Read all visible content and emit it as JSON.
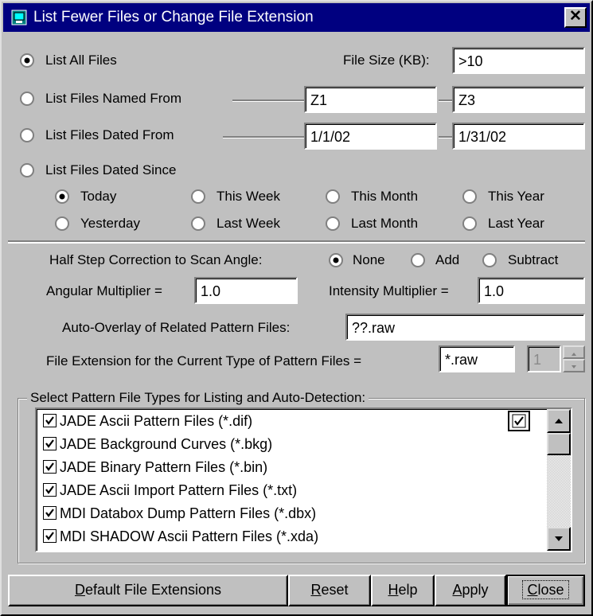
{
  "window": {
    "title": "List Fewer Files or Change File Extension",
    "close_glyph": "✕"
  },
  "filter": {
    "list_all": "List All Files",
    "file_size_label": "File Size (KB):",
    "file_size_value": ">10",
    "named_from": "List Files Named From",
    "named_from_value": "Z1",
    "named_to_value": "Z3",
    "dated_from": "List Files Dated From",
    "dated_from_value": "1/1/02",
    "dated_to_value": "1/31/02",
    "dated_since": "List Files Dated Since",
    "selected": "List All Files"
  },
  "since_options": {
    "today": "Today",
    "this_week": "This Week",
    "this_month": "This Month",
    "this_year": "This Year",
    "yesterday": "Yesterday",
    "last_week": "Last Week",
    "last_month": "Last Month",
    "last_year": "Last Year",
    "selected": "Today"
  },
  "correction": {
    "label": "Half Step Correction to Scan Angle:",
    "none": "None",
    "add": "Add",
    "subtract": "Subtract",
    "selected": "None"
  },
  "multipliers": {
    "angular_label": "Angular Multiplier =",
    "angular_value": "1.0",
    "intensity_label": "Intensity Multiplier =",
    "intensity_value": "1.0"
  },
  "overlay": {
    "label": "Auto-Overlay of Related Pattern Files:",
    "value": "??.raw"
  },
  "extension": {
    "label": "File Extension for the Current Type of Pattern Files =",
    "value": "*.raw",
    "spin_value": "1"
  },
  "file_types": {
    "group_title": "Select Pattern File Types for Listing and Auto-Detection:",
    "items": [
      {
        "label": "JADE Ascii Pattern Files (*.dif)",
        "checked": true
      },
      {
        "label": "JADE Background Curves (*.bkg)",
        "checked": true
      },
      {
        "label": "JADE Binary Pattern Files (*.bin)",
        "checked": true
      },
      {
        "label": "JADE Ascii Import Pattern Files (*.txt)",
        "checked": true
      },
      {
        "label": "MDI Databox Dump Pattern Files (*.dbx)",
        "checked": true
      },
      {
        "label": "MDI SHADOW Ascii Pattern Files (*.xda)",
        "checked": true
      }
    ]
  },
  "buttons": {
    "default_ext_u": "D",
    "default_ext_rest": "efault File Extensions",
    "reset_u": "R",
    "reset_rest": "eset",
    "help_u": "H",
    "help_rest": "elp",
    "apply_u": "A",
    "apply_rest": "pply",
    "close_u": "C",
    "close_rest": "lose"
  },
  "colors": {
    "titlebar": "#000080",
    "face": "#c0c0c0"
  }
}
